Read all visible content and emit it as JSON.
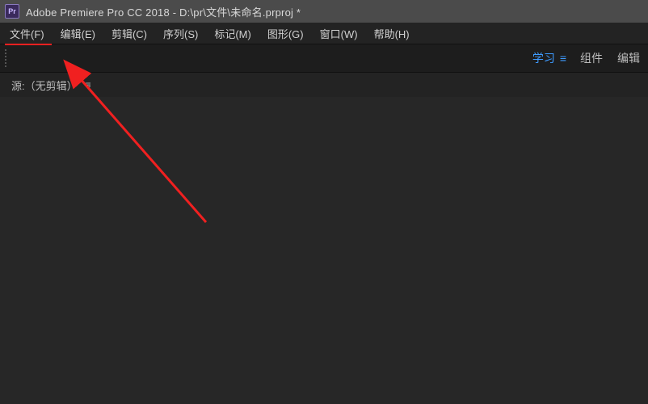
{
  "titlebar": {
    "app_abbrev": "Pr",
    "title": "Adobe Premiere Pro CC 2018 - D:\\pr\\文件\\未命名.prproj *"
  },
  "menubar": {
    "items": [
      {
        "label": "文件(F)"
      },
      {
        "label": "编辑(E)"
      },
      {
        "label": "剪辑(C)"
      },
      {
        "label": "序列(S)"
      },
      {
        "label": "标记(M)"
      },
      {
        "label": "图形(G)"
      },
      {
        "label": "窗口(W)"
      },
      {
        "label": "帮助(H)"
      }
    ]
  },
  "tabs": {
    "learn": "学习",
    "assembly": "组件",
    "edit": "编辑"
  },
  "source": {
    "label": "源:（无剪辑）"
  },
  "annotation": {
    "highlight_target": "文件(F)",
    "arrow_color": "#f02020"
  }
}
